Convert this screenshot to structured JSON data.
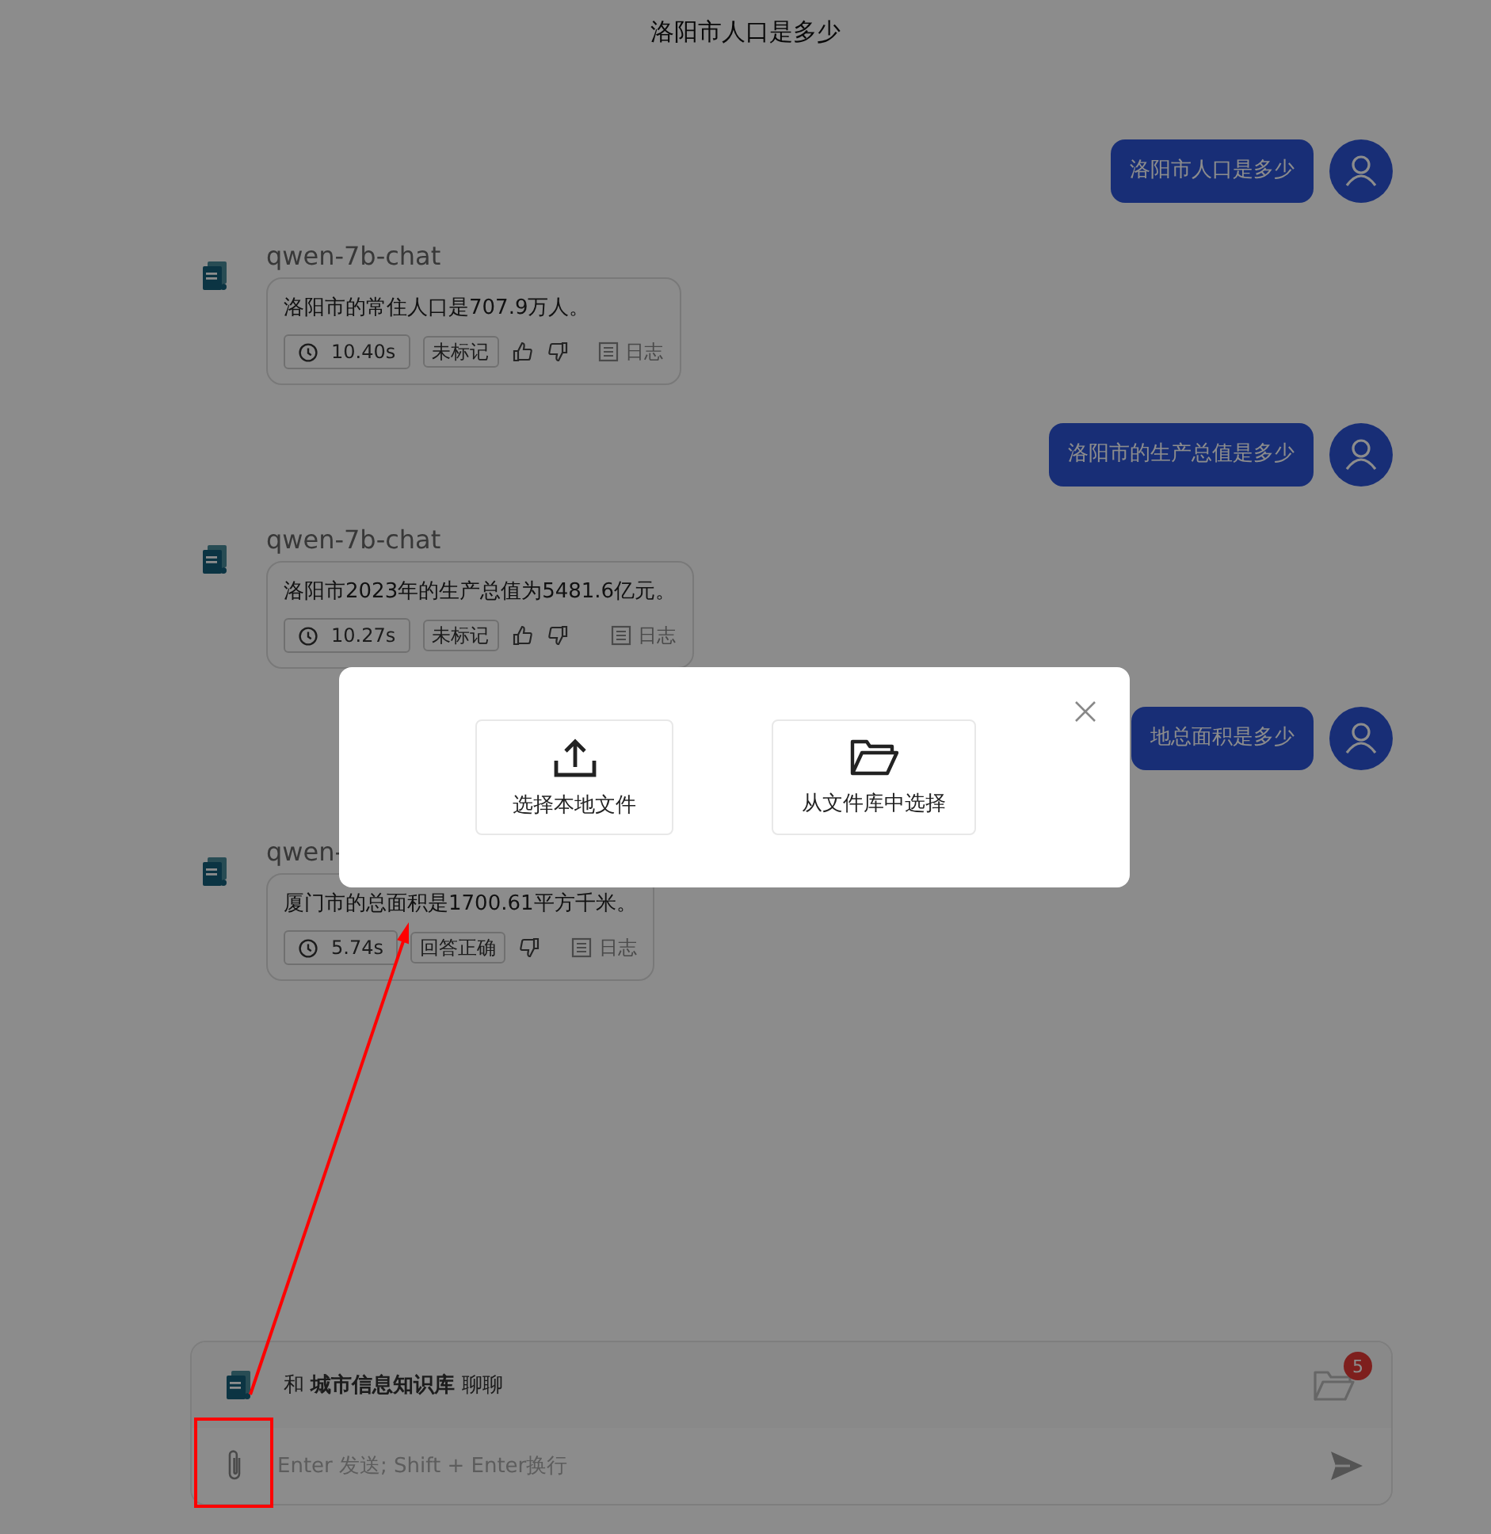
{
  "title": "洛阳市人口是多少",
  "messages": [
    {
      "kind": "user",
      "text": "洛阳市人口是多少"
    },
    {
      "kind": "bot",
      "model": "qwen-7b-chat",
      "text": "洛阳市的常住人口是707.9万人。",
      "time": "10.40s",
      "tag": "未标记",
      "like": true,
      "dislike": true,
      "log": "日志"
    },
    {
      "kind": "user",
      "text": "洛阳市的生产总值是多少"
    },
    {
      "kind": "bot",
      "model": "qwen-7b-chat",
      "text": "洛阳市2023年的生产总值为5481.6亿元。",
      "time": "10.27s",
      "tag": "未标记",
      "like": true,
      "dislike": true,
      "log": "日志"
    },
    {
      "kind": "user",
      "text": "地总面积是多少"
    },
    {
      "kind": "bot",
      "model": "qwen-",
      "text": "厦门市的总面积是1700.61平方千米。",
      "time": "5.74s",
      "tag": "回答正确",
      "like": false,
      "dislike": true,
      "log": "日志"
    }
  ],
  "modal": {
    "options": [
      {
        "kind": "upload",
        "label": "选择本地文件"
      },
      {
        "kind": "library",
        "label": "从文件库中选择"
      }
    ]
  },
  "composer": {
    "kb_line": "和 **城市信息知识库** 聊聊",
    "badge": "5",
    "placeholder": "Enter 发送; Shift + Enter换行"
  }
}
